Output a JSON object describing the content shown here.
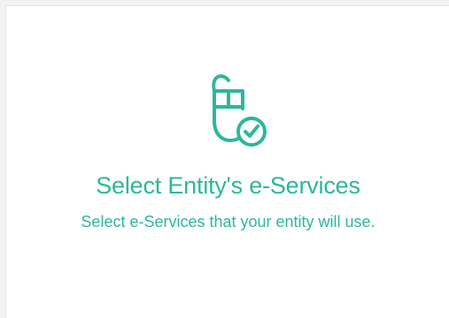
{
  "panel": {
    "icon": "mouse-check-icon",
    "title": "Select Entity's e-Services",
    "subtitle": "Select e-Services that your entity will use."
  },
  "colors": {
    "accent": "#2db79a",
    "background": "#ffffff"
  }
}
